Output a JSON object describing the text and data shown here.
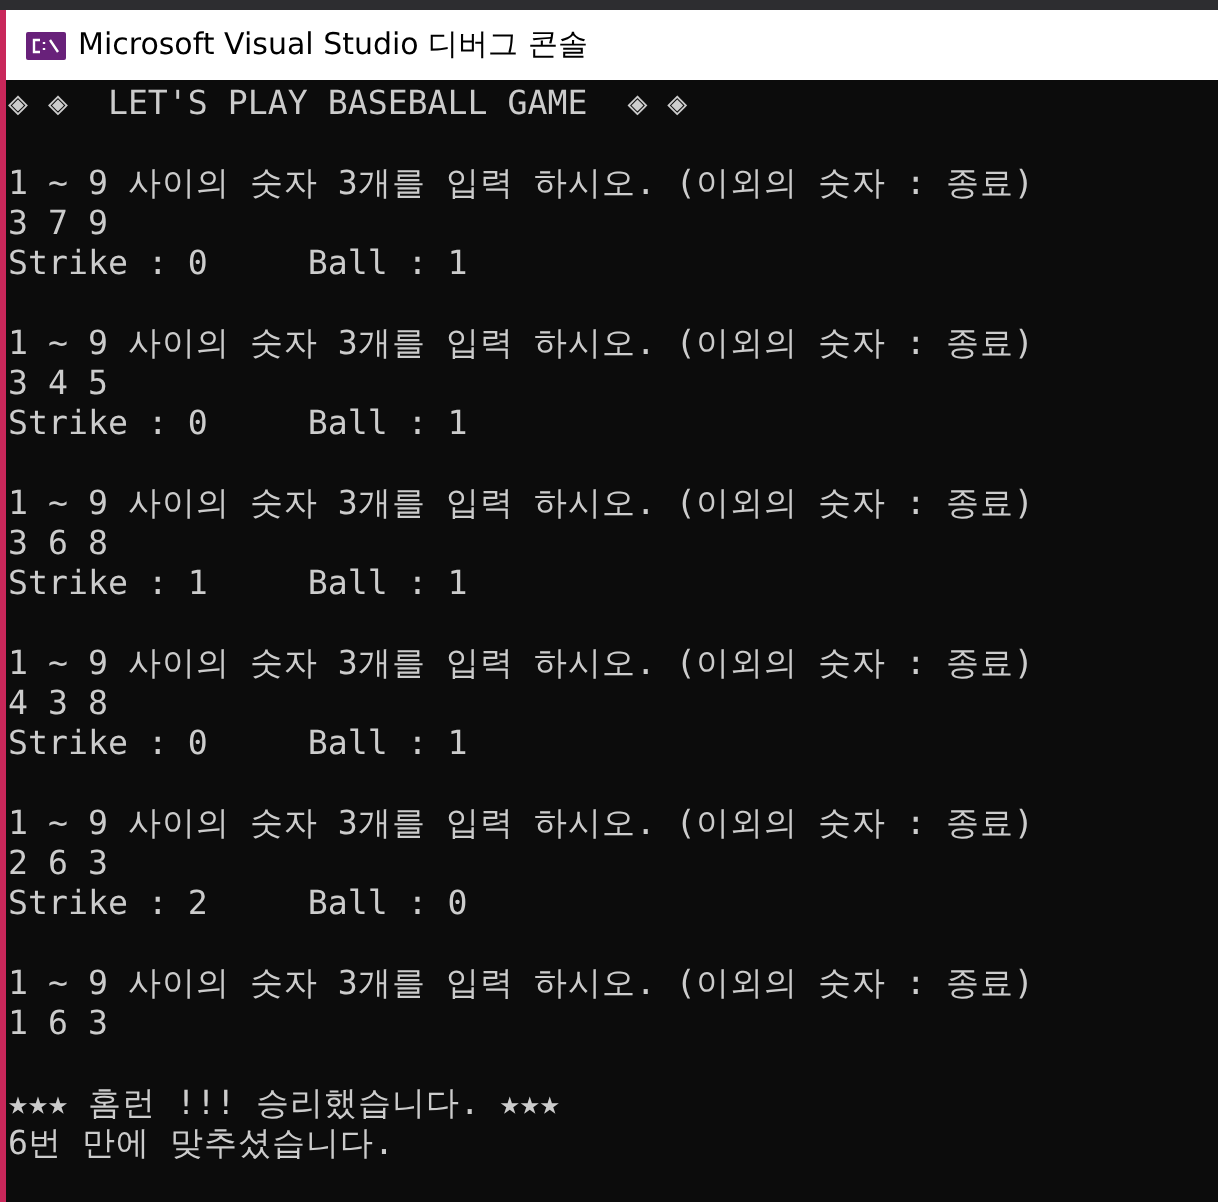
{
  "window": {
    "title": "Microsoft Visual Studio 디버그 콘솔"
  },
  "console": {
    "lines": [
      {
        "kind": "text",
        "text": "◈ ◈  LET'S PLAY BASEBALL GAME  ◈ ◈"
      },
      {
        "kind": "blank"
      },
      {
        "kind": "text",
        "text": "1 ~ 9 사이의 숫자 3개를 입력 하시오. (이외의 숫자 : 종료)"
      },
      {
        "kind": "text",
        "text": "3 7 9"
      },
      {
        "kind": "text",
        "text": "Strike : 0     Ball : 1"
      },
      {
        "kind": "blank"
      },
      {
        "kind": "text",
        "text": "1 ~ 9 사이의 숫자 3개를 입력 하시오. (이외의 숫자 : 종료)"
      },
      {
        "kind": "text",
        "text": "3 4 5"
      },
      {
        "kind": "text",
        "text": "Strike : 0     Ball : 1"
      },
      {
        "kind": "blank"
      },
      {
        "kind": "text",
        "text": "1 ~ 9 사이의 숫자 3개를 입력 하시오. (이외의 숫자 : 종료)"
      },
      {
        "kind": "text",
        "text": "3 6 8"
      },
      {
        "kind": "text",
        "text": "Strike : 1     Ball : 1"
      },
      {
        "kind": "blank"
      },
      {
        "kind": "text",
        "text": "1 ~ 9 사이의 숫자 3개를 입력 하시오. (이외의 숫자 : 종료)"
      },
      {
        "kind": "text",
        "text": "4 3 8"
      },
      {
        "kind": "text",
        "text": "Strike : 0     Ball : 1"
      },
      {
        "kind": "blank"
      },
      {
        "kind": "text",
        "text": "1 ~ 9 사이의 숫자 3개를 입력 하시오. (이외의 숫자 : 종료)"
      },
      {
        "kind": "text",
        "text": "2 6 3"
      },
      {
        "kind": "text",
        "text": "Strike : 2     Ball : 0"
      },
      {
        "kind": "blank"
      },
      {
        "kind": "text",
        "text": "1 ~ 9 사이의 숫자 3개를 입력 하시오. (이외의 숫자 : 종료)"
      },
      {
        "kind": "text",
        "text": "1 6 3"
      },
      {
        "kind": "blank"
      },
      {
        "kind": "text",
        "text": "★★★ 홈런 !!! 승리했습니다. ★★★"
      },
      {
        "kind": "text",
        "text": "6번 만에 맞추셨습니다."
      }
    ]
  }
}
